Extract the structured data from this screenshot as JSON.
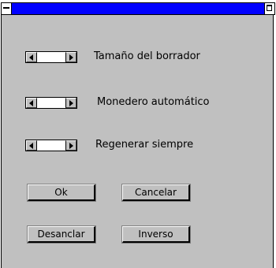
{
  "titlebar": {
    "title": "",
    "color": "#0000ff"
  },
  "options": [
    {
      "label": "Tamaño del borrador"
    },
    {
      "label": "Monedero automático"
    },
    {
      "label": "Regenerar siempre"
    }
  ],
  "buttons": {
    "ok": "Ok",
    "cancel": "Cancelar",
    "unanchor": "Desanclar",
    "inverse": "Inverso"
  }
}
